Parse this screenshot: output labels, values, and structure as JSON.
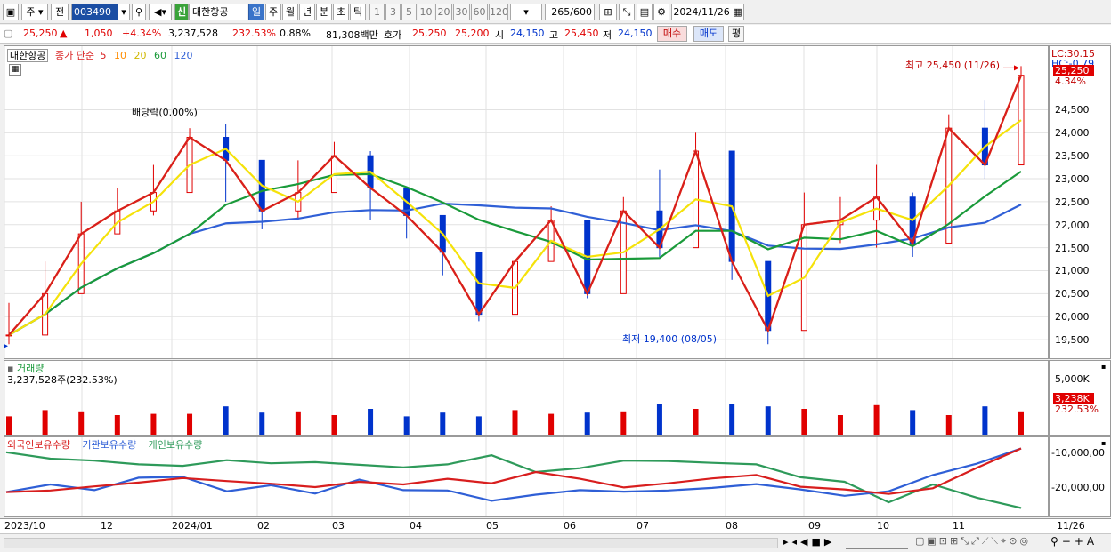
{
  "toolbar": {
    "period_type": "주",
    "mode": "전",
    "code": "003490",
    "sin_badge": "신",
    "name": "대한항공",
    "tabs": [
      "일",
      "주",
      "월",
      "년",
      "분",
      "초",
      "틱"
    ],
    "active_tab": "일",
    "ticks": [
      "1",
      "3",
      "5",
      "10",
      "20",
      "30",
      "60",
      "120"
    ],
    "count": "265",
    "count_total": "/600",
    "date": "2024/11/26"
  },
  "quote": {
    "price": "25,250",
    "arrow": "▲",
    "change": "1,050",
    "rate": "+4.34%",
    "volume": "3,237,528",
    "vol_rate": "232.53%",
    "turnover": "0.88%",
    "amount": "81,308백만",
    "hoga_label": "호가",
    "ask": "25,250",
    "bid": "25,200",
    "open_label": "시",
    "open": "24,150",
    "high_label": "고",
    "high": "25,450",
    "low_label": "저",
    "low": "24,150",
    "buy": "매수",
    "sell": "매도",
    "flat": "평"
  },
  "colors": {
    "up": "#e00000",
    "down": "#0033cc",
    "ma5": "#d81e1e",
    "ma10": "#ff8c00",
    "ma20": "#f5e20a",
    "ma60": "#1a9a3a",
    "ma120": "#2f5fd6",
    "foreign": "#d81e1e",
    "inst": "#2f5fd6",
    "retail": "#2e9a5a"
  },
  "price_panel": {
    "name": "대한항공",
    "ma_label": "종가 단순",
    "ma_periods": [
      "5",
      "10",
      "20",
      "60",
      "120"
    ],
    "lc": "LC:30.15",
    "hc": "HC:-0.79",
    "cur_price": "25,250",
    "cur_rate": "4.34%",
    "max_label": "최고 25,450 (11/26)",
    "min_label": "최저 19,400 (08/05)",
    "dividend": "배당락(0.00%)",
    "y_ticks": [
      "24,500",
      "24,000",
      "23,500",
      "23,000",
      "22,500",
      "22,000",
      "21,500",
      "21,000",
      "20,500",
      "20,000",
      "19,500"
    ]
  },
  "volume_panel": {
    "title": "거래량",
    "summary": "3,237,528주(232.53%)",
    "y_tick": "5,000K",
    "cur": "3,238K",
    "cur_rate": "232.53%"
  },
  "holding_panel": {
    "legend": [
      "외국인보유수량",
      "기관보유수량",
      "개인보유수량"
    ],
    "y_ticks": [
      "-10,000,00",
      "-20,000,00"
    ]
  },
  "x_labels": [
    "2023/10",
    "12",
    "2024/01",
    "02",
    "03",
    "04",
    "05",
    "06",
    "07",
    "08",
    "09",
    "10",
    "11",
    "11/26"
  ],
  "chart_data": {
    "type": "candlestick",
    "title": "대한항공",
    "y_unit": "KRW",
    "ylim": [
      19250,
      25650
    ],
    "ma_periods": [
      5,
      10,
      20,
      60,
      120
    ],
    "x": [
      "2023/10",
      "2023/10 mid",
      "2023/11",
      "2023/11 mid",
      "2023/12",
      "2023/12 mid",
      "2024/01",
      "2024/01 mid",
      "2024/02",
      "2024/02 mid",
      "2024/03",
      "2024/03 mid",
      "2024/04",
      "2024/04 mid",
      "2024/05",
      "2024/05 mid",
      "2024/06",
      "2024/06 mid",
      "2024/07",
      "2024/07 mid",
      "2024/08",
      "2024/08 mid",
      "2024/09",
      "2024/09 mid",
      "2024/10",
      "2024/10 mid",
      "2024/11",
      "2024/11 mid",
      "2024/11/26"
    ],
    "close": [
      19600,
      20500,
      21800,
      22300,
      22700,
      23900,
      23400,
      22300,
      22700,
      23500,
      22800,
      22200,
      21400,
      20050,
      21200,
      22100,
      20500,
      22300,
      21500,
      23600,
      21200,
      19700,
      22000,
      22100,
      22600,
      21600,
      24100,
      23300,
      25250
    ],
    "high": [
      20300,
      21200,
      22500,
      22800,
      23300,
      24100,
      24200,
      23100,
      23400,
      23800,
      23600,
      22600,
      22100,
      20800,
      21800,
      22400,
      21600,
      22600,
      23200,
      24000,
      22700,
      21100,
      22700,
      22600,
      23300,
      22700,
      24400,
      24700,
      25450
    ],
    "low": [
      19400,
      19800,
      21200,
      21800,
      22200,
      23000,
      22500,
      21900,
      22100,
      22800,
      22100,
      21700,
      20900,
      19900,
      20400,
      21300,
      20400,
      21300,
      21300,
      22500,
      20800,
      19400,
      21200,
      21600,
      21500,
      21300,
      23400,
      23000,
      24150
    ],
    "holding": {
      "foreign": [
        -20500,
        -20100,
        -19000,
        -18000,
        -16800,
        -17600,
        -18300,
        -19200,
        -17800,
        -18500,
        -17000,
        -18200,
        -15200,
        -17000,
        -19300,
        -18200,
        -16900,
        -16000,
        -19100,
        -19800,
        -21000,
        -19500,
        -14100,
        -9000
      ],
      "institution": [
        -20500,
        -18500,
        -20000,
        -16700,
        -16500,
        -20300,
        -18700,
        -20900,
        -17200,
        -20000,
        -20100,
        -22800,
        -21200,
        -20000,
        -20400,
        -20100,
        -19400,
        -18400,
        -19800,
        -21500,
        -20300,
        -16000,
        -13000,
        -9000
      ],
      "individual": [
        -10000,
        -11700,
        -12200,
        -13200,
        -13600,
        -12100,
        -12900,
        -12600,
        -13300,
        -14000,
        -13200,
        -10800,
        -15200,
        -14200,
        -12200,
        -12300,
        -12800,
        -13200,
        -16600,
        -17800,
        -23200,
        -18500,
        -22000,
        -24700
      ]
    }
  }
}
